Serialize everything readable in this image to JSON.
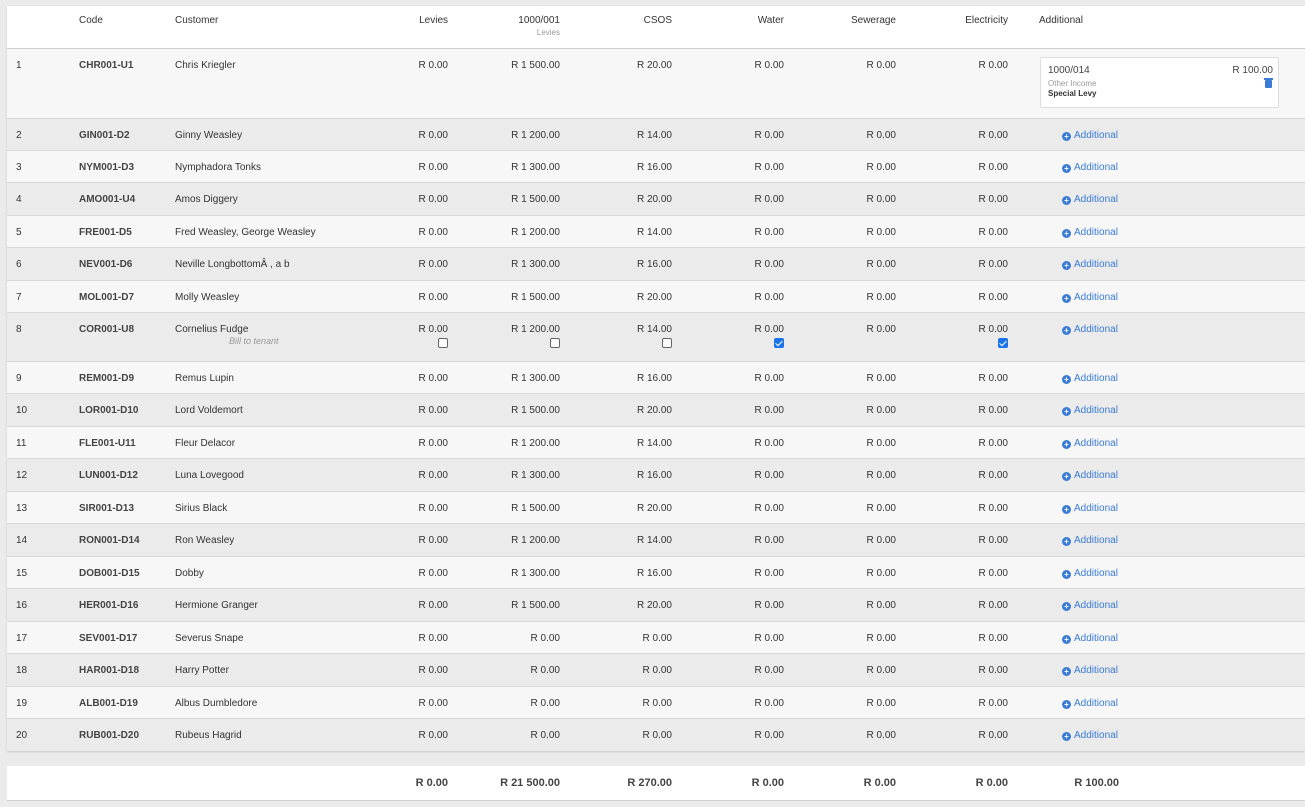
{
  "headers": {
    "code": "Code",
    "customer": "Customer",
    "levies": "Levies",
    "acc1000": "1000/001",
    "acc1000_sub": "Levies",
    "csos": "CSOS",
    "water": "Water",
    "sewerage": "Sewerage",
    "electricity": "Electricity",
    "additional": "Additional"
  },
  "add_label": "Additional",
  "bill_to_tenant": "Bill to tenant",
  "rows": [
    {
      "num": "1",
      "code": "CHR001-U1",
      "customer": "Chris Kriegler",
      "levies": "R 0.00",
      "acc1000": "R 1 500.00",
      "csos": "R 20.00",
      "water": "R 0.00",
      "sewerage": "R 0.00",
      "electricity": "R 0.00"
    },
    {
      "num": "2",
      "code": "GIN001-D2",
      "customer": "Ginny Weasley",
      "levies": "R 0.00",
      "acc1000": "R 1 200.00",
      "csos": "R 14.00",
      "water": "R 0.00",
      "sewerage": "R 0.00",
      "electricity": "R 0.00"
    },
    {
      "num": "3",
      "code": "NYM001-D3",
      "customer": "Nymphadora Tonks",
      "levies": "R 0.00",
      "acc1000": "R 1 300.00",
      "csos": "R 16.00",
      "water": "R 0.00",
      "sewerage": "R 0.00",
      "electricity": "R 0.00"
    },
    {
      "num": "4",
      "code": "AMO001-U4",
      "customer": "Amos Diggery",
      "levies": "R 0.00",
      "acc1000": "R 1 500.00",
      "csos": "R 20.00",
      "water": "R 0.00",
      "sewerage": "R 0.00",
      "electricity": "R 0.00"
    },
    {
      "num": "5",
      "code": "FRE001-D5",
      "customer": "Fred Weasley, George Weasley",
      "levies": "R 0.00",
      "acc1000": "R 1 200.00",
      "csos": "R 14.00",
      "water": "R 0.00",
      "sewerage": "R 0.00",
      "electricity": "R 0.00"
    },
    {
      "num": "6",
      "code": "NEV001-D6",
      "customer": "Neville LongbottomÂ , a b",
      "levies": "R 0.00",
      "acc1000": "R 1 300.00",
      "csos": "R 16.00",
      "water": "R 0.00",
      "sewerage": "R 0.00",
      "electricity": "R 0.00"
    },
    {
      "num": "7",
      "code": "MOL001-D7",
      "customer": "Molly Weasley",
      "levies": "R 0.00",
      "acc1000": "R 1 500.00",
      "csos": "R 20.00",
      "water": "R 0.00",
      "sewerage": "R 0.00",
      "electricity": "R 0.00"
    },
    {
      "num": "8",
      "code": "COR001-U8",
      "customer": "Cornelius Fudge",
      "levies": "R 0.00",
      "acc1000": "R 1 200.00",
      "csos": "R 14.00",
      "water": "R 0.00",
      "sewerage": "R 0.00",
      "electricity": "R 0.00"
    },
    {
      "num": "9",
      "code": "REM001-D9",
      "customer": "Remus Lupin",
      "levies": "R 0.00",
      "acc1000": "R 1 300.00",
      "csos": "R 16.00",
      "water": "R 0.00",
      "sewerage": "R 0.00",
      "electricity": "R 0.00"
    },
    {
      "num": "10",
      "code": "LOR001-D10",
      "customer": "Lord Voldemort",
      "levies": "R 0.00",
      "acc1000": "R 1 500.00",
      "csos": "R 20.00",
      "water": "R 0.00",
      "sewerage": "R 0.00",
      "electricity": "R 0.00"
    },
    {
      "num": "11",
      "code": "FLE001-U11",
      "customer": "Fleur Delacor",
      "levies": "R 0.00",
      "acc1000": "R 1 200.00",
      "csos": "R 14.00",
      "water": "R 0.00",
      "sewerage": "R 0.00",
      "electricity": "R 0.00"
    },
    {
      "num": "12",
      "code": "LUN001-D12",
      "customer": "Luna Lovegood",
      "levies": "R 0.00",
      "acc1000": "R 1 300.00",
      "csos": "R 16.00",
      "water": "R 0.00",
      "sewerage": "R 0.00",
      "electricity": "R 0.00"
    },
    {
      "num": "13",
      "code": "SIR001-D13",
      "customer": "Sirius Black",
      "levies": "R 0.00",
      "acc1000": "R 1 500.00",
      "csos": "R 20.00",
      "water": "R 0.00",
      "sewerage": "R 0.00",
      "electricity": "R 0.00"
    },
    {
      "num": "14",
      "code": "RON001-D14",
      "customer": "Ron Weasley",
      "levies": "R 0.00",
      "acc1000": "R 1 200.00",
      "csos": "R 14.00",
      "water": "R 0.00",
      "sewerage": "R 0.00",
      "electricity": "R 0.00"
    },
    {
      "num": "15",
      "code": "DOB001-D15",
      "customer": "Dobby",
      "levies": "R 0.00",
      "acc1000": "R 1 300.00",
      "csos": "R 16.00",
      "water": "R 0.00",
      "sewerage": "R 0.00",
      "electricity": "R 0.00"
    },
    {
      "num": "16",
      "code": "HER001-D16",
      "customer": "Hermione Granger",
      "levies": "R 0.00",
      "acc1000": "R 1 500.00",
      "csos": "R 20.00",
      "water": "R 0.00",
      "sewerage": "R 0.00",
      "electricity": "R 0.00"
    },
    {
      "num": "17",
      "code": "SEV001-D17",
      "customer": "Severus Snape",
      "levies": "R 0.00",
      "acc1000": "R 0.00",
      "csos": "R 0.00",
      "water": "R 0.00",
      "sewerage": "R 0.00",
      "electricity": "R 0.00"
    },
    {
      "num": "18",
      "code": "HAR001-D18",
      "customer": "Harry Potter",
      "levies": "R 0.00",
      "acc1000": "R 0.00",
      "csos": "R 0.00",
      "water": "R 0.00",
      "sewerage": "R 0.00",
      "electricity": "R 0.00"
    },
    {
      "num": "19",
      "code": "ALB001-D19",
      "customer": "Albus Dumbledore",
      "levies": "R 0.00",
      "acc1000": "R 0.00",
      "csos": "R 0.00",
      "water": "R 0.00",
      "sewerage": "R 0.00",
      "electricity": "R 0.00"
    },
    {
      "num": "20",
      "code": "RUB001-D20",
      "customer": "Rubeus Hagrid",
      "levies": "R 0.00",
      "acc1000": "R 0.00",
      "csos": "R 0.00",
      "water": "R 0.00",
      "sewerage": "R 0.00",
      "electricity": "R 0.00"
    }
  ],
  "row1_additional": {
    "code": "1000/014",
    "amount": "R 100.00",
    "category": "Other Income",
    "description": "Special Levy"
  },
  "row8_checkboxes": {
    "levies": false,
    "acc1000": false,
    "csos": false,
    "water": true,
    "electricity": true
  },
  "totals": {
    "levies": "R 0.00",
    "acc1000": "R 21 500.00",
    "csos": "R 270.00",
    "water": "R 0.00",
    "sewerage": "R 0.00",
    "electricity": "R 0.00",
    "additional": "R 100.00"
  },
  "colors": {
    "accent": "#3a7bd5",
    "checkbox": "#1a73e8"
  }
}
